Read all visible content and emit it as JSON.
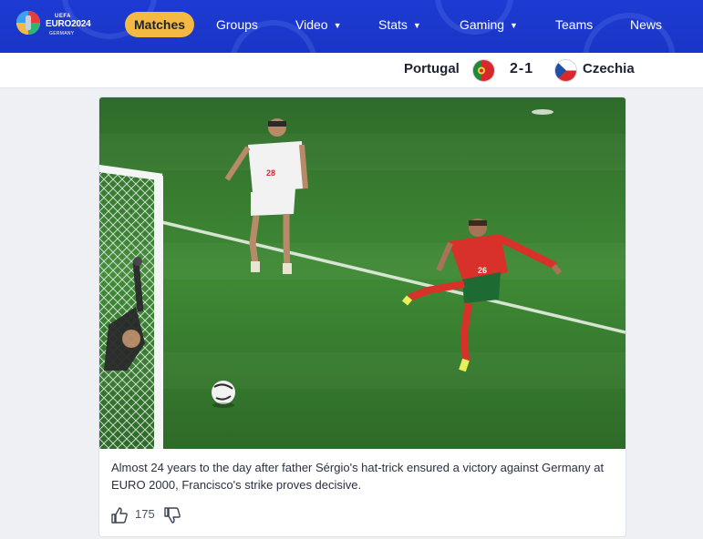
{
  "header": {
    "logo": {
      "uefa": "UEFA",
      "title": "EURO2024",
      "host": "GERMANY"
    },
    "nav": [
      {
        "label": "Matches",
        "active": true,
        "dropdown": false
      },
      {
        "label": "Groups",
        "active": false,
        "dropdown": false
      },
      {
        "label": "Video",
        "active": false,
        "dropdown": true
      },
      {
        "label": "Stats",
        "active": false,
        "dropdown": true
      },
      {
        "label": "Gaming",
        "active": false,
        "dropdown": true
      },
      {
        "label": "Teams",
        "active": false,
        "dropdown": false
      },
      {
        "label": "News",
        "active": false,
        "dropdown": false
      }
    ],
    "accent": "#f4b942",
    "background": "#1d3bd3"
  },
  "score_bar": {
    "home": "Portugal",
    "away": "Czechia",
    "score": "2-1"
  },
  "article": {
    "caption": "Almost 24 years to the day after father Sérgio's hat-trick ensured a victory against Germany at EURO 2000, Francisco's strike proves decisive.",
    "likes": "175",
    "icons": {
      "like": "thumbs-up-icon",
      "dislike": "thumbs-down-icon"
    }
  }
}
